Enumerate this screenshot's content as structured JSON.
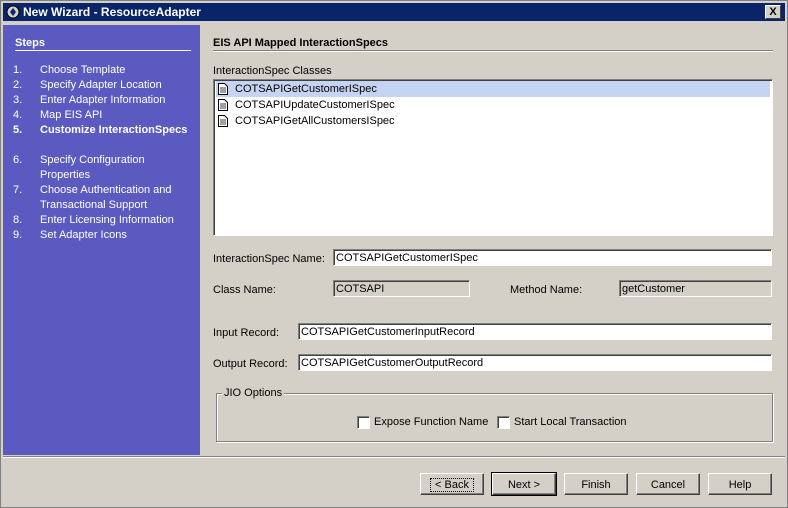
{
  "window": {
    "title": "New Wizard - ResourceAdapter",
    "close_label": "X"
  },
  "steps": {
    "title": "Steps",
    "items": [
      {
        "num": "1.",
        "label": "Choose Template"
      },
      {
        "num": "2.",
        "label": "Specify Adapter Location"
      },
      {
        "num": "3.",
        "label": "Enter Adapter Information"
      },
      {
        "num": "4.",
        "label": "Map EIS API"
      },
      {
        "num": "5.",
        "label": "Customize InteractionSpecs"
      },
      {
        "num": "6.",
        "label": "Specify Configuration Properties"
      },
      {
        "num": "7.",
        "label": "Choose Authentication and Transactional Support"
      },
      {
        "num": "8.",
        "label": "Enter Licensing Information"
      },
      {
        "num": "9.",
        "label": "Set Adapter Icons"
      }
    ],
    "current_index": 4
  },
  "main": {
    "heading": "EIS API Mapped InteractionSpecs",
    "list_label": "InteractionSpec Classes",
    "list_items": [
      "COTSAPIGetCustomerISpec",
      "COTSAPIUpdateCustomerISpec",
      "COTSAPIGetAllCustomersISpec"
    ],
    "selected_index": 0,
    "spec_name_label": "InteractionSpec Name:",
    "spec_name_value": "COTSAPIGetCustomerISpec",
    "class_name_label": "Class Name:",
    "class_name_value": "COTSAPI",
    "method_name_label": "Method Name:",
    "method_name_value": "getCustomer",
    "input_record_label": "Input Record:",
    "input_record_value": "COTSAPIGetCustomerInputRecord",
    "output_record_label": "Output Record:",
    "output_record_value": "COTSAPIGetCustomerOutputRecord",
    "jio": {
      "legend": "JIO Options",
      "expose_label": "Expose Function Name",
      "expose_checked": false,
      "transaction_label": "Start Local Transaction",
      "transaction_checked": false
    }
  },
  "buttons": {
    "back": "< Back",
    "next": "Next >",
    "finish": "Finish",
    "cancel": "Cancel",
    "help": "Help"
  }
}
